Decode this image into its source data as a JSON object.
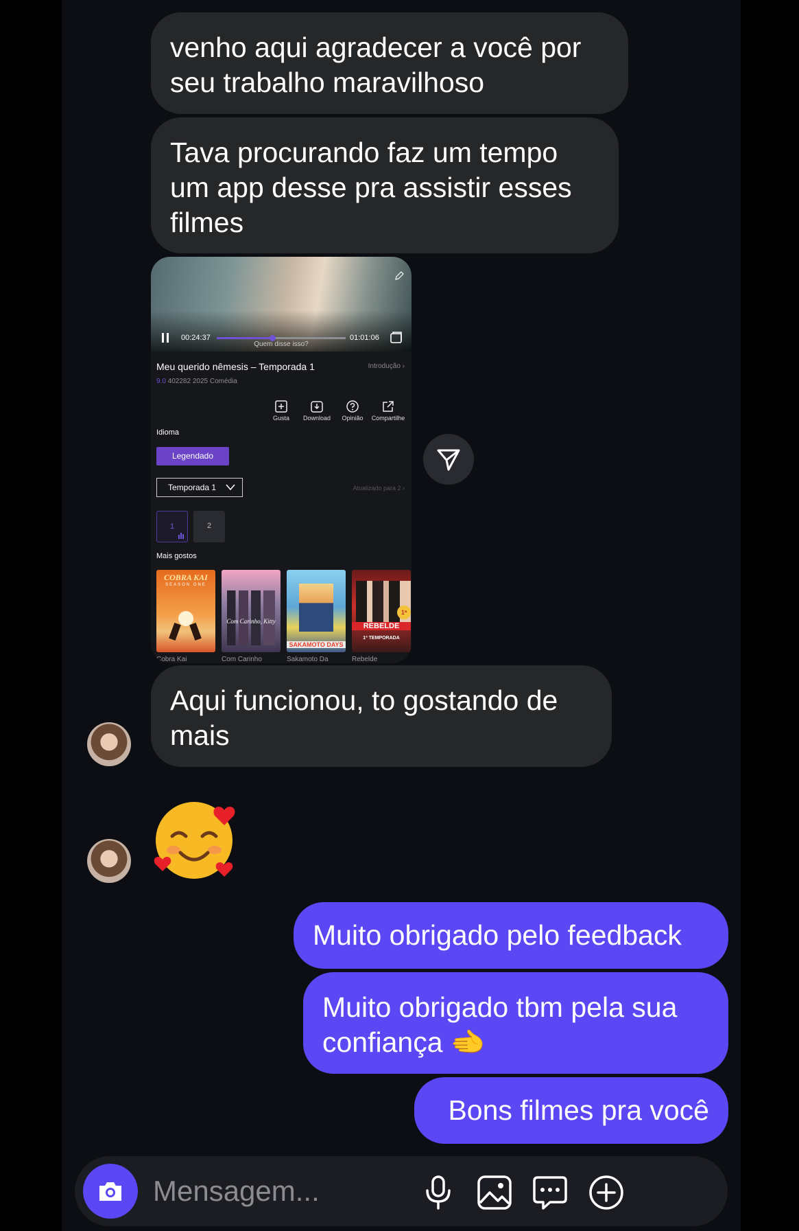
{
  "messages": {
    "incoming": [
      "venho aqui agradecer a você por seu trabalho maravilhoso",
      "Tava procurando faz um tempo um app desse pra assistir esses filmes",
      "Aqui funcionou, to gostando de mais"
    ],
    "incoming_emoji": "🥰",
    "outgoing": [
      "Muito obrigado pelo feedback",
      "Muito obrigado tbm pela sua confiança 🫲",
      "Bons filmes pra você"
    ]
  },
  "shared": {
    "time_current": "00:24:37",
    "time_total": "01:01:06",
    "progress": 0.43,
    "subtitle": "Quem disse isso?",
    "title": "Meu querido nêmesis – Temporada 1",
    "intro_link": "Introdução",
    "rating": "9.0",
    "meta": "402282 2025 Comédia",
    "actions": [
      "Gusta",
      "Download",
      "Opinião",
      "Compartilhe"
    ],
    "language_label": "Idioma",
    "language_value": "Legendado",
    "season_select": "Temporada 1",
    "updated_text": "Atualizado para 2",
    "episodes": [
      "1",
      "2"
    ],
    "more_label": "Mais gostos",
    "posters": [
      "Cobra Kai",
      "Com Carinho",
      "Sakamoto Da",
      "Rebelde"
    ],
    "poster_art": [
      "COBRA KAI",
      "SEASON ONE",
      "Com Carinho, Kitty",
      "SAKAMOTO DAYS",
      "REBELDE",
      "1ª TEMPORADA"
    ]
  },
  "composer": {
    "placeholder": "Mensagem..."
  },
  "colors": {
    "background": "#0c0e13",
    "incoming_bubble": "#262729",
    "outgoing_bubble": "#5b47f4",
    "accent": "#6a43c7"
  }
}
